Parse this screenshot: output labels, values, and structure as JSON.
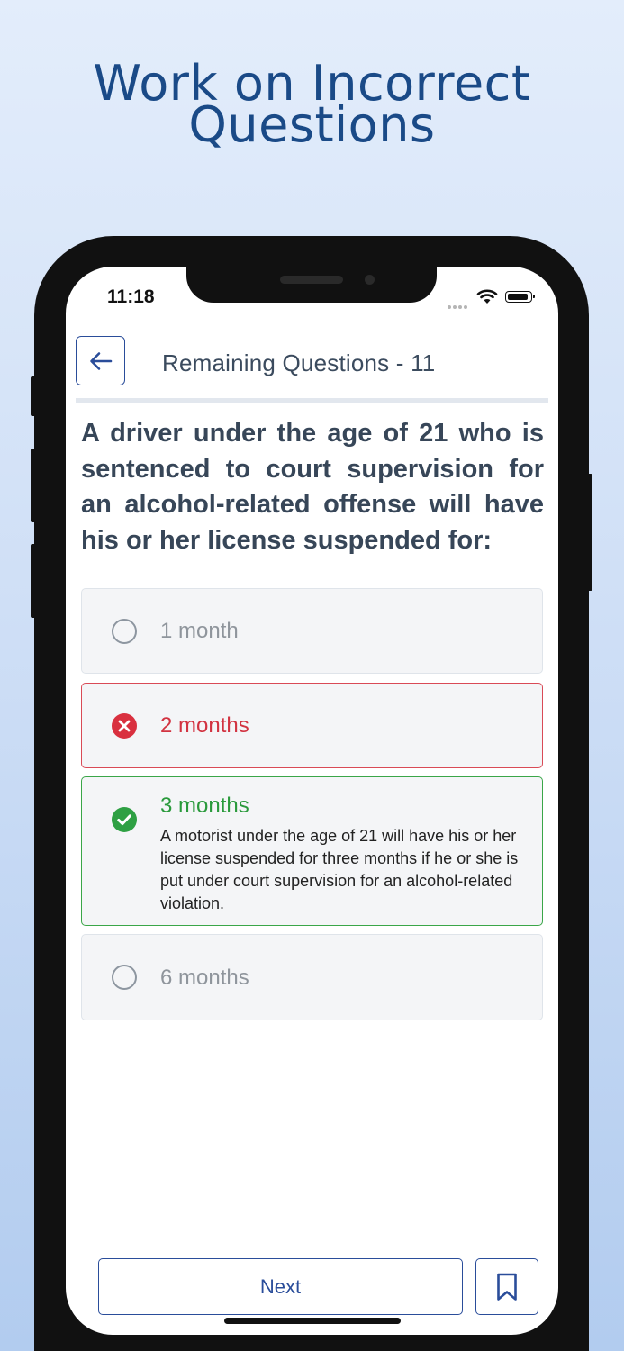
{
  "promo": {
    "title_line1": "Work on Incorrect",
    "title_line2": "Questions"
  },
  "status_bar": {
    "time": "11:18"
  },
  "header": {
    "back_icon": "arrow-left-icon",
    "title": "Remaining Questions - 11"
  },
  "question": {
    "text": "A driver under the age of 21 who is sentenced to court supervision for an alcohol-related offense will have his or her license suspended for:"
  },
  "options": [
    {
      "label": "1 month",
      "state": "unselected"
    },
    {
      "label": "2 months",
      "state": "incorrect"
    },
    {
      "label": "3 months",
      "state": "correct",
      "explanation": "A motorist under the age of 21 will have his or her license suspended for three months if he or she is put under court supervision for an alcohol-related violation."
    },
    {
      "label": "6 months",
      "state": "unselected"
    }
  ],
  "footer": {
    "next_label": "Next",
    "bookmark_icon": "bookmark-icon"
  },
  "colors": {
    "accent": "#2a4d9a",
    "correct": "#2a9a3c",
    "incorrect": "#d23341",
    "promo_title": "#1a4a87"
  }
}
